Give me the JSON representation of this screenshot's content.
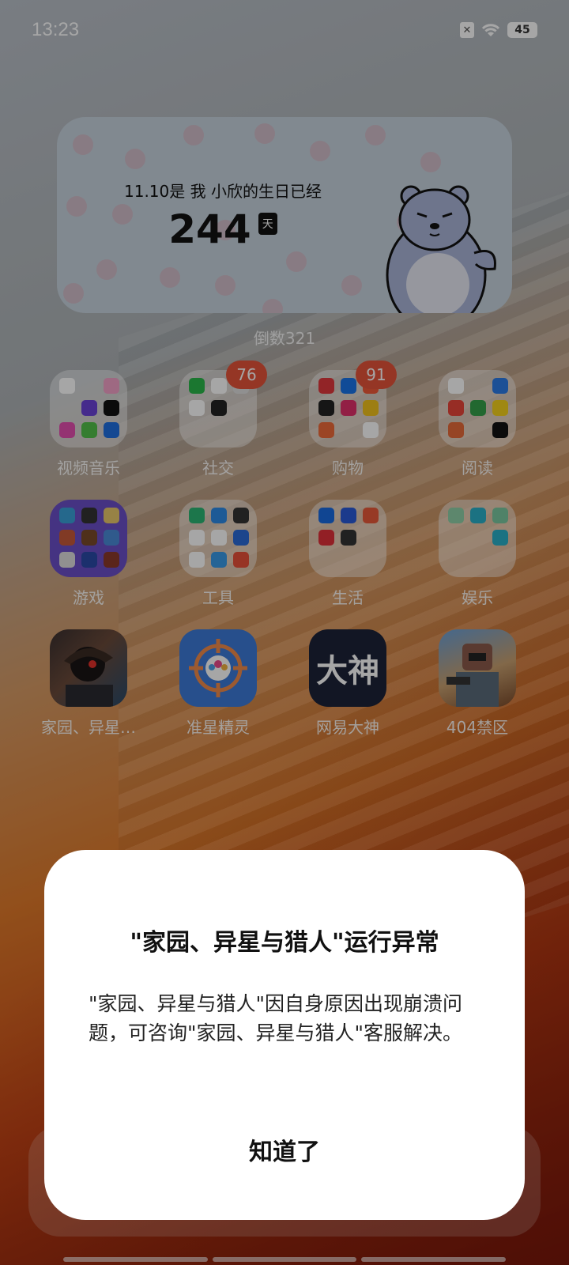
{
  "status_bar": {
    "time": "13:23",
    "battery": "45"
  },
  "widget": {
    "title": "11.10是 我 小欣的生日已经",
    "number": "244",
    "unit": "天"
  },
  "widget_label": "倒数321",
  "apps": [
    {
      "label": "视频音乐"
    },
    {
      "label": "社交",
      "badge": "76"
    },
    {
      "label": "购物",
      "badge": "91"
    },
    {
      "label": "阅读"
    },
    {
      "label": "游戏"
    },
    {
      "label": "工具"
    },
    {
      "label": "生活"
    },
    {
      "label": "娱乐"
    },
    {
      "label": "家园、异星…",
      "icon": "game-icon"
    },
    {
      "label": "准星精灵",
      "icon": "crosshair-icon"
    },
    {
      "label": "网易大神",
      "icon_text": "大神"
    },
    {
      "label": "404禁区",
      "icon": "game-icon"
    }
  ],
  "dialog": {
    "title": "\"家园、异星与猎人\"运行异常",
    "body": "\"家园、异星与猎人\"因自身原因出现崩溃问题，可咨询\"家园、异星与猎人\"客服解决。",
    "button": "知道了"
  },
  "colors": {
    "badge": "#e5533a",
    "widget_bg": "#c7d3de"
  }
}
